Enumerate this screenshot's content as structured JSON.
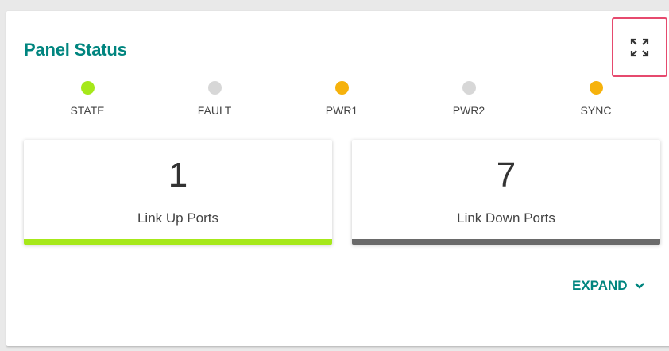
{
  "panel": {
    "title": "Panel Status",
    "fullscreen_icon": "fullscreen-icon"
  },
  "leds": [
    {
      "label": "STATE",
      "color": "#a6e81a"
    },
    {
      "label": "FAULT",
      "color": "#d7d7d7"
    },
    {
      "label": "PWR1",
      "color": "#f6b20c"
    },
    {
      "label": "PWR2",
      "color": "#d7d7d7"
    },
    {
      "label": "SYNC",
      "color": "#f6b20c"
    }
  ],
  "cards": [
    {
      "value": "1",
      "label": "Link Up Ports",
      "bar_color": "#a6e81a"
    },
    {
      "value": "7",
      "label": "Link Down Ports",
      "bar_color": "#6a6a6a"
    }
  ],
  "expand": {
    "label": "EXPAND",
    "icon": "chevron-down-icon"
  },
  "colors": {
    "accent": "#00857f",
    "highlight_border": "#e64a6e"
  }
}
